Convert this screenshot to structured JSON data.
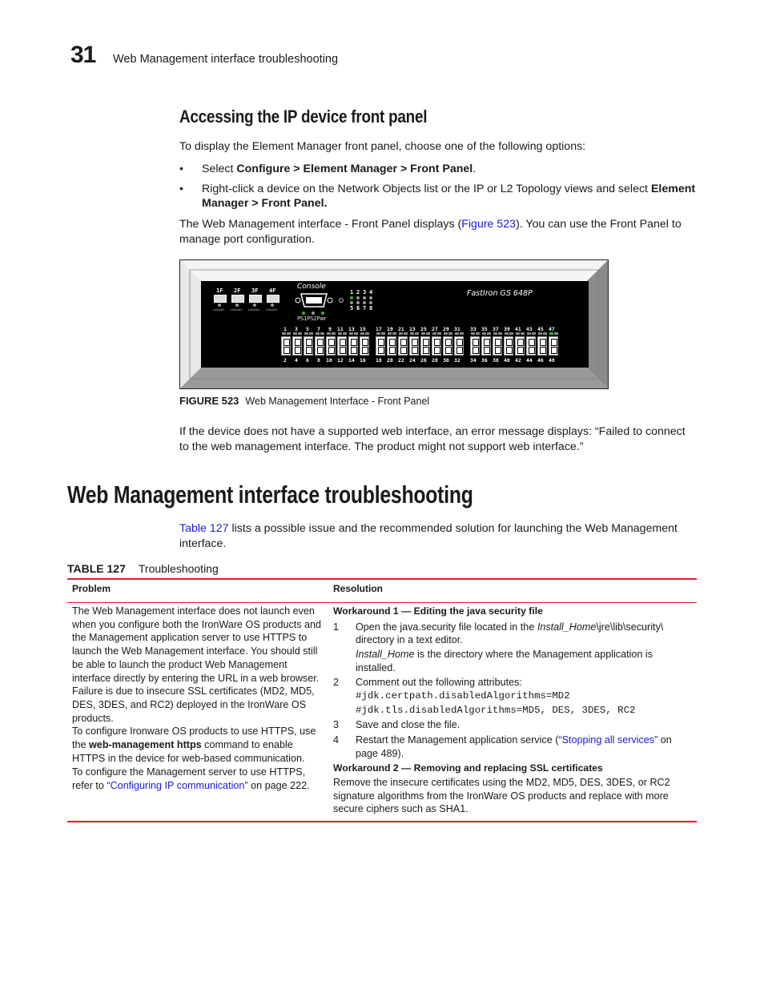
{
  "header": {
    "chapter_number": "31",
    "running_title": "Web Management interface troubleshooting"
  },
  "section1": {
    "heading": "Accessing the IP device front panel",
    "intro": "To display the Element Manager front panel, choose one of the following options:",
    "bullets": [
      {
        "prefix": "Select ",
        "bold": "Configure > Element Manager > Front Panel",
        "suffix": "."
      },
      {
        "prefix": "Right-click a device on the Network Objects list or the IP or L2 Topology views and select ",
        "bold": "Element Manager > Front Panel.",
        "suffix": ""
      }
    ],
    "para2_pre": "The Web Management interface - Front Panel displays (",
    "para2_link": "Figure 523",
    "para2_post": "). You can use the Front Panel to manage port configuration.",
    "figure": {
      "label": "FIGURE 523",
      "caption": "Web Management Interface - Front Panel",
      "device_name": "FastIron GS 648P",
      "console_label": "Console",
      "uplink_ports": [
        "1F",
        "2F",
        "3F",
        "4F"
      ],
      "link_act_label": "Link/Act",
      "status_labels": [
        "PS1",
        "PS2",
        "Pwr"
      ],
      "status_leds": [
        "green",
        "gray",
        "green"
      ],
      "slot_numbers_top": [
        "1",
        "2",
        "3",
        "4"
      ],
      "slot_numbers_bottom": [
        "5",
        "6",
        "7",
        "8"
      ],
      "slot_led_active": "1",
      "port_count": 48,
      "active_port": "47",
      "led_green": "#22c02a",
      "led_gray": "#9a9a9a"
    },
    "para3": "If the device does not have a supported web interface, an error message displays: “Failed to connect to the web management interface. The product might not support web interface.”"
  },
  "section2": {
    "heading": "Web Management interface troubleshooting",
    "intro_link": "Table 127",
    "intro_post": " lists a possible issue and the recommended solution for launching the Web Management interface.",
    "table": {
      "label": "TABLE 127",
      "caption": "Troubleshooting",
      "columns": [
        "Problem",
        "Resolution"
      ],
      "problem": {
        "p1": "The Web Management interface does not launch even when you configure both the IronWare OS products and the Management application server to use HTTPS to launch the Web Management interface. You should still be able to launch the product Web Management interface directly by entering the URL in a web browser.",
        "p2": "Failure is due to insecure SSL certificates (MD2, MD5, DES, 3DES, and RC2) deployed in the IronWare OS products.",
        "p3_pre": "To configure Ironware OS products to use HTTPS, use the ",
        "p3_bold": "web-management https",
        "p3_post": " command to enable HTTPS in the device for web-based communication.",
        "p4_pre": "To configure the Management server to use HTTPS, refer to ",
        "p4_link": "“Configuring IP communication”",
        "p4_post": " on page 222."
      },
      "resolution": {
        "w1_heading": "Workaround 1 — Editing the java security file",
        "step1_num": "1",
        "step1_pre": "Open the java.security file located in the ",
        "step1_italic": "Install_Home",
        "step1_post": "\\jre\\lib\\security\\ directory in a text editor.",
        "step1_note_italic": "Install_Home",
        "step1_note_post": " is the directory where the Management application is installed.",
        "step2_num": "2",
        "step2_text": "Comment out the following attributes:",
        "code1": "#jdk.certpath.disabledAlgorithms=MD2",
        "code2": "#jdk.tls.disabledAlgorithms=MD5, DES, 3DES, RC2",
        "step3_num": "3",
        "step3_text": "Save and close the file.",
        "step4_num": "4",
        "step4_pre": "Restart the Management application service (",
        "step4_link": "“Stopping all services”",
        "step4_post": " on page 489).",
        "w2_heading": "Workaround 2 — Removing and replacing SSL certificates",
        "w2_text": "Remove the insecure certificates using the MD2, MD5, DES, 3DES, or RC2 signature algorithms from the IronWare OS products and replace with more secure ciphers such as SHA1."
      }
    }
  }
}
